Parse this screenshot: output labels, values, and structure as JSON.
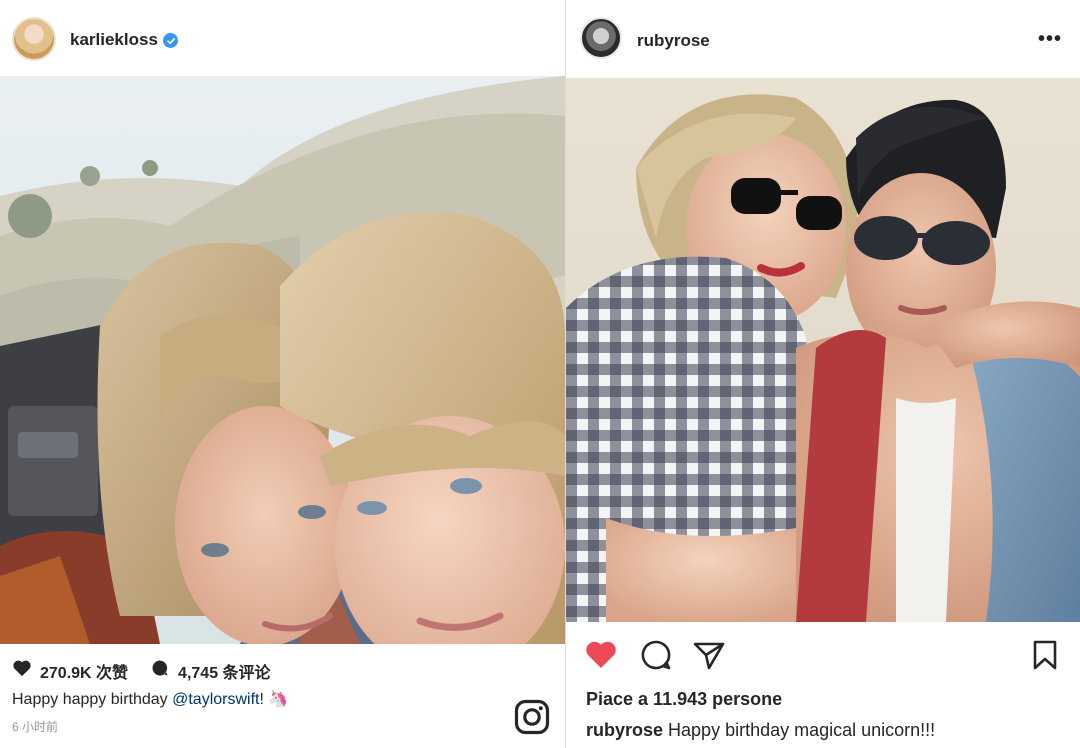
{
  "left_post": {
    "username": "karliekloss",
    "verified_icon": "verified-badge-icon",
    "likes": "270.9K 次赞",
    "comments": "4,745 条评论",
    "caption_text": "Happy happy birthday ",
    "caption_mention": "@taylorswift!",
    "caption_emoji": "🦄",
    "timestamp": "6 小时前",
    "icons": [
      "heart-icon",
      "comment-icon",
      "instagram-logo-icon"
    ]
  },
  "right_post": {
    "username": "rubyrose",
    "more_icon": "•••",
    "likes": "Piace a 11.943 persone",
    "caption_user": "rubyrose",
    "caption_text": " Happy birthday magical unicorn!!!",
    "icons": [
      "heart-filled-icon",
      "comment-icon",
      "share-icon",
      "bookmark-icon"
    ]
  },
  "colors": {
    "heart_red": "#ed4956",
    "verified_blue": "#3897f0",
    "text": "#262626",
    "muted": "#999999"
  }
}
